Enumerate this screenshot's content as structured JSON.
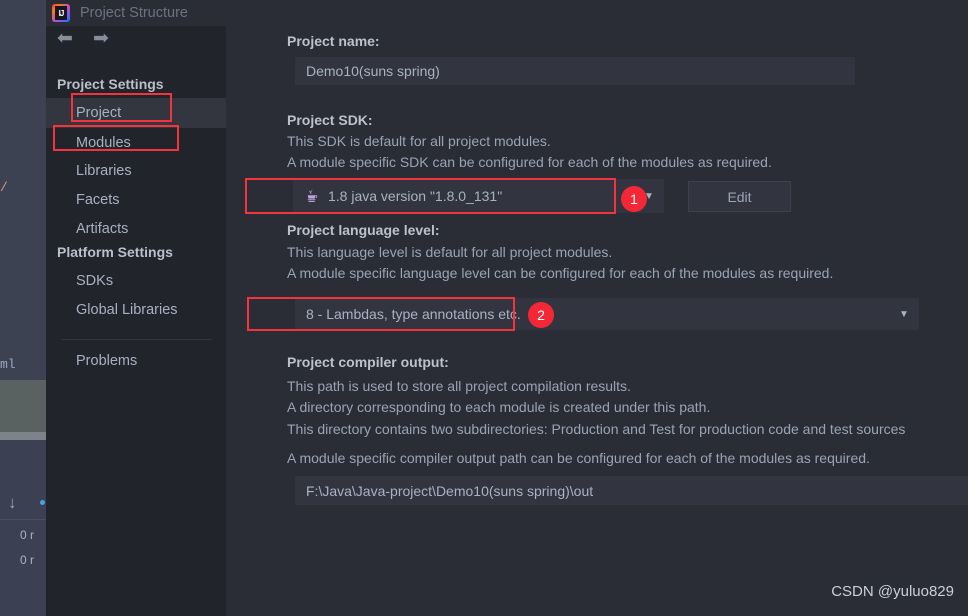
{
  "window": {
    "title": "Project Structure",
    "logo_icon": "intellij-idea-logo"
  },
  "nav": {
    "back_icon": "arrow-left-icon",
    "forward_icon": "arrow-right-icon"
  },
  "sidebar": {
    "groups": [
      {
        "label": "Project Settings"
      },
      {
        "label": "Platform Settings"
      }
    ],
    "items": [
      {
        "label": "Project",
        "selected": true
      },
      {
        "label": "Modules",
        "selected": false
      },
      {
        "label": "Libraries",
        "selected": false
      },
      {
        "label": "Facets",
        "selected": false
      },
      {
        "label": "Artifacts",
        "selected": false
      },
      {
        "label": "SDKs",
        "selected": false
      },
      {
        "label": "Global Libraries",
        "selected": false
      },
      {
        "label": "Problems",
        "selected": false
      }
    ]
  },
  "main": {
    "project_name": {
      "label": "Project name:",
      "value": "Demo10(suns spring)"
    },
    "project_sdk": {
      "label": "Project SDK:",
      "desc_line_1": "This SDK is default for all project modules.",
      "desc_line_2": "A module specific SDK can be configured for each of the modules as required.",
      "value": "1.8 java version \"1.8.0_131\"",
      "icon": "java-coffee-cup-icon",
      "dropdown_icon": "chevron-down-icon",
      "edit_button": "Edit"
    },
    "language_level": {
      "label": "Project language level:",
      "desc_line_1": "This language level is default for all project modules.",
      "desc_line_2": "A module specific language level can be configured for each of the modules as required.",
      "value": "8 - Lambdas, type annotations etc.",
      "dropdown_icon": "chevron-down-icon"
    },
    "compiler_output": {
      "label": "Project compiler output:",
      "desc_line_1": "This path is used to store all project compilation results.",
      "desc_line_2": "A directory corresponding to each module is created under this path.",
      "desc_line_3": "This directory contains two subdirectories: Production and Test for production code and test sources",
      "desc_line_4": "A module specific compiler output path can be configured for each of the modules as required.",
      "value": "F:\\Java\\Java-project\\Demo10(suns spring)\\out"
    }
  },
  "annotations": {
    "marker_1": "1",
    "marker_2": "2",
    "highlight_color": "#f4333c"
  },
  "background_ide": {
    "code_fragment_1": "/",
    "code_fragment_2": "ml",
    "down_arrow_icon": "arrow-down-icon",
    "count_1": "0 r",
    "count_2": "0 r"
  },
  "watermark": {
    "text": "CSDN @yuluo829"
  }
}
